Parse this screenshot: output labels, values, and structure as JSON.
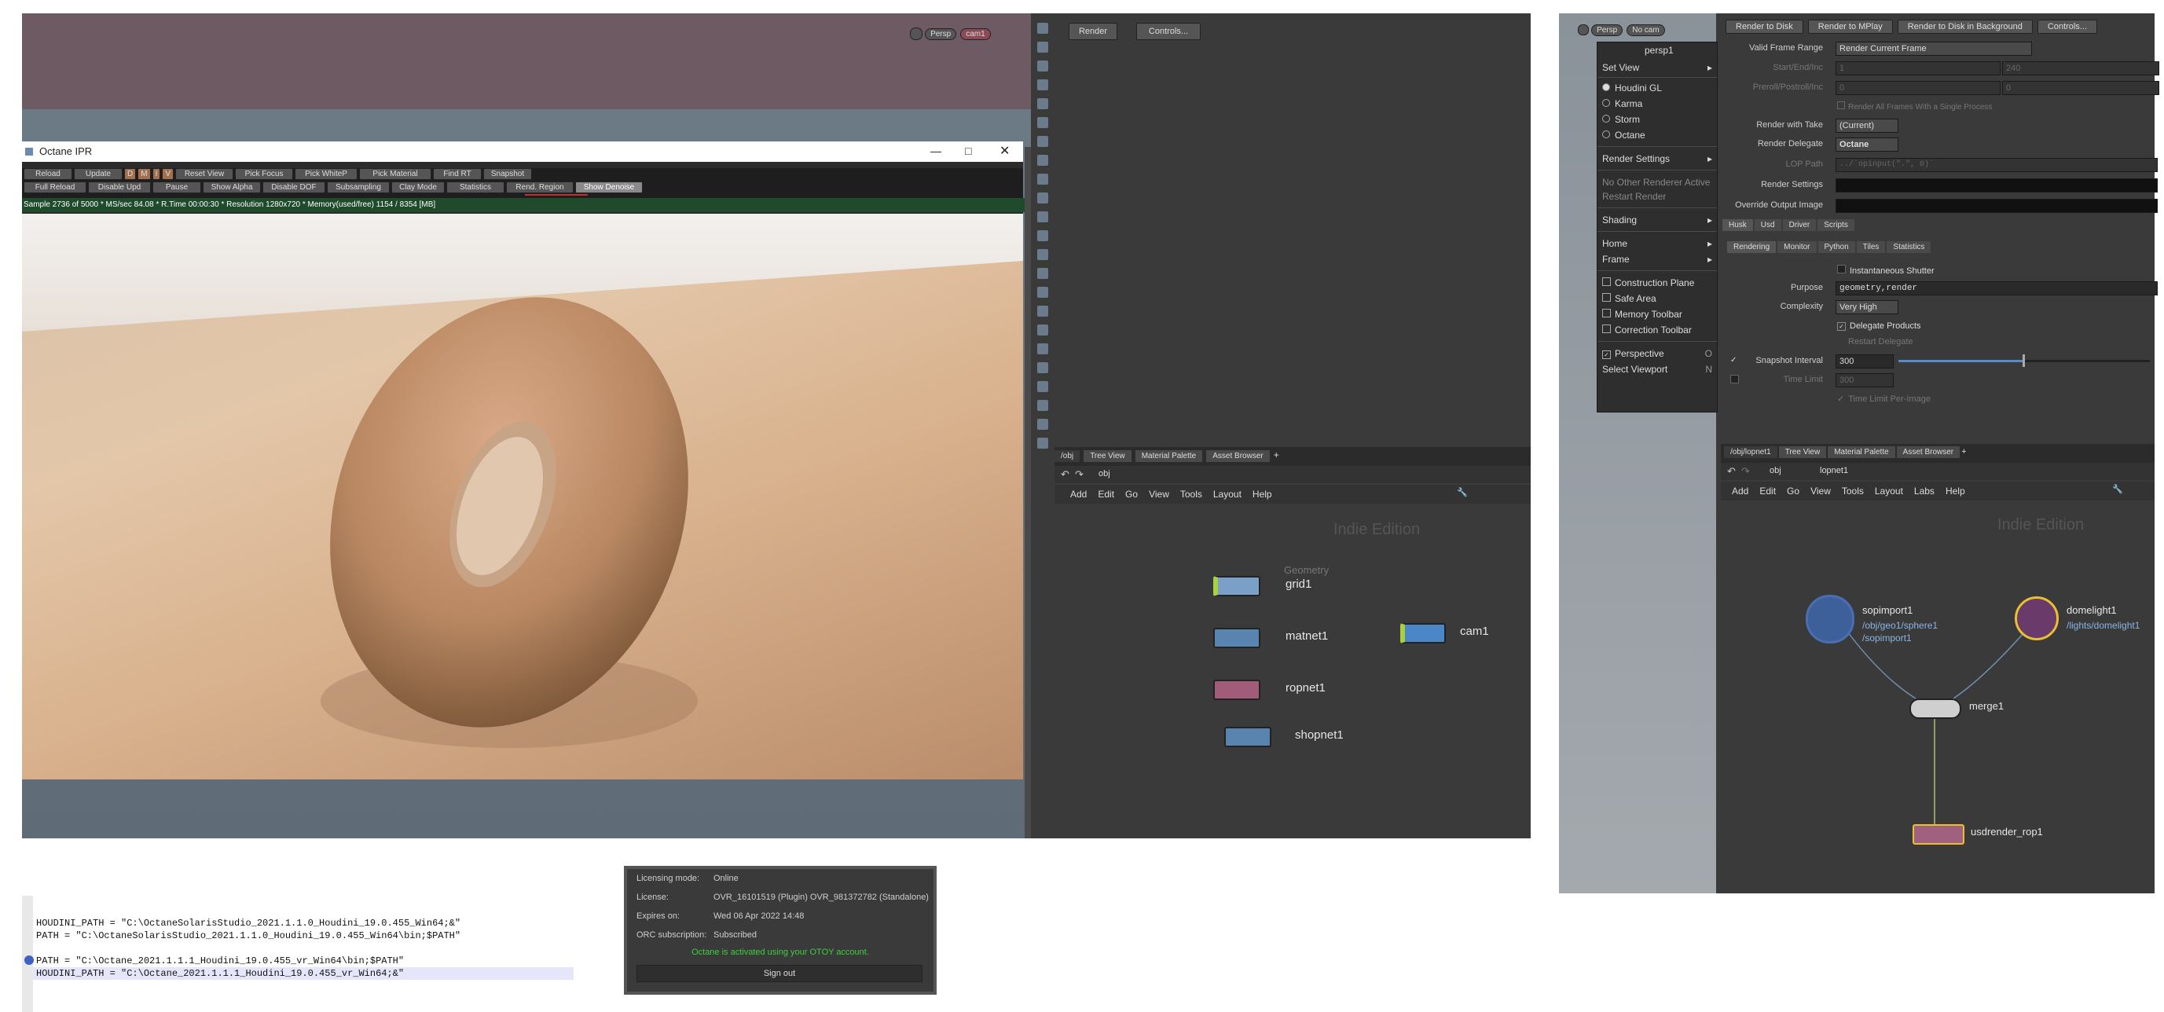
{
  "top_viewport": {
    "persp": "Persp",
    "cam": "cam1"
  },
  "ipr": {
    "title": "Octane IPR",
    "row1": [
      "Reload",
      "Update",
      "D",
      "M",
      "I",
      "V",
      "Reset View",
      "Pick Focus",
      "Pick WhiteP",
      "Pick Material",
      "Find RT",
      "Snapshot"
    ],
    "row2": [
      "Full Reload",
      "Disable Upd",
      "Pause",
      "Show Alpha",
      "Disable DOF",
      "Subsampling",
      "Clay Mode",
      "Statistics",
      "Rend. Region",
      "Show Denoise"
    ],
    "status": "Sample 2736 of 5000 * MS/sec 84.08 * R.Time 00:00:30 * Resolution 1280x720 * Memory(used/free) 1154 / 8354 [MB]"
  },
  "mid": {
    "render_btn": "Render",
    "controls_btn": "Controls...",
    "tabs": [
      "/obj",
      "Tree View",
      "Material Palette",
      "Asset Browser"
    ],
    "path": "obj",
    "menu": [
      "Add",
      "Edit",
      "Go",
      "View",
      "Tools",
      "Layout",
      "Help"
    ],
    "watermark": "Indie Edition",
    "geometry_label": "Geometry",
    "nodes": {
      "grid": "grid1",
      "matnet": "matnet1",
      "ropnet": "ropnet1",
      "shopnet": "shopnet1",
      "cam": "cam1"
    }
  },
  "right": {
    "persp": "Persp",
    "nocam": "No cam",
    "menu_title": "persp1",
    "menu_items": {
      "set_view": "Set View",
      "houdini_gl": "Houdini GL",
      "karma": "Karma",
      "storm": "Storm",
      "octane": "Octane",
      "render_settings": "Render Settings",
      "no_other": "No Other Renderer Active",
      "restart": "Restart Render",
      "shading": "Shading",
      "home": "Home",
      "frame": "Frame",
      "construction_plane": "Construction Plane",
      "safe_area": "Safe Area",
      "memory_toolbar": "Memory Toolbar",
      "correction_toolbar": "Correction Toolbar",
      "perspective": "Perspective",
      "perspective_key": "O",
      "select_viewport": "Select Viewport",
      "select_viewport_key": "N"
    },
    "buttons": [
      "Render to Disk",
      "Render to MPlay",
      "Render to Disk in Background",
      "Controls..."
    ],
    "props": {
      "valid_frame_range_label": "Valid Frame Range",
      "valid_frame_range_val": "Render Current Frame",
      "start_end_label": "Start/End/Inc",
      "start_val": "1",
      "end_val": "240",
      "preroll_label": "Preroll/Postroll/Inc",
      "preroll_val": "0",
      "postroll_val": "0",
      "render_all_frames": "Render All Frames With a Single Process",
      "render_with_take_label": "Render with Take",
      "render_with_take_val": "(Current)",
      "render_delegate_label": "Render Delegate",
      "render_delegate_val": "Octane",
      "lop_path_label": "LOP Path",
      "lop_path_val": "../`opinput(\".\", 0)`",
      "render_settings_label": "Render Settings",
      "override_output_label": "Override Output Image"
    },
    "tabs1": [
      "Husk",
      "Usd",
      "Driver",
      "Scripts"
    ],
    "tabs2": [
      "Rendering",
      "Monitor",
      "Python",
      "Tiles",
      "Statistics"
    ],
    "husk": {
      "instantaneous_shutter": "Instantaneous Shutter",
      "purpose_label": "Purpose",
      "purpose_val": "geometry,render",
      "complexity_label": "Complexity",
      "complexity_val": "Very High",
      "delegate_products": "Delegate Products",
      "restart_delegate": "Restart Delegate",
      "snapshot_label": "Snapshot Interval",
      "snapshot_val": "300",
      "time_limit_label": "Time Limit",
      "time_limit_val": "300",
      "time_limit_per_image": "Time Limit Per-Image"
    },
    "net_tabs": [
      "/obj/lopnet1",
      "Tree View",
      "Material Palette",
      "Asset Browser"
    ],
    "path1": "obj",
    "path2": "lopnet1",
    "menu": [
      "Add",
      "Edit",
      "Go",
      "View",
      "Tools",
      "Layout",
      "Labs",
      "Help"
    ],
    "watermark": "Indie Edition",
    "nodes": {
      "sopimport": "sopimport1",
      "sopimport_path1": "/obj/geo1/sphere1",
      "sopimport_path2": "/sopimport1",
      "domelight": "domelight1",
      "domelight_path": "/lights/domelight1",
      "merge": "merge1",
      "usdrender": "usdrender_rop1"
    }
  },
  "code": {
    "line1": "HOUDINI_PATH = \"C:\\OctaneSolarisStudio_2021.1.1.0_Houdini_19.0.455_Win64;&\"",
    "line2": "PATH = \"C:\\OctaneSolarisStudio_2021.1.1.0_Houdini_19.0.455_Win64\\bin;$PATH\"",
    "line3": "PATH = \"C:\\Octane_2021.1.1.1_Houdini_19.0.455_vr_Win64\\bin;$PATH\"",
    "line4": "HOUDINI_PATH = \"C:\\Octane_2021.1.1.1_Houdini_19.0.455_vr_Win64;&\""
  },
  "license": {
    "mode_label": "Licensing mode:",
    "mode_val": "Online",
    "license_label": "License:",
    "license_val": "OVR_16101519 (Plugin) OVR_981372782 (Standalone)",
    "expires_label": "Expires on:",
    "expires_val": "Wed 06 Apr 2022 14:48",
    "orc_label": "ORC subscription:",
    "orc_val": "Subscribed",
    "activated": "Octane is activated using your OTOY account.",
    "signout": "Sign out"
  }
}
